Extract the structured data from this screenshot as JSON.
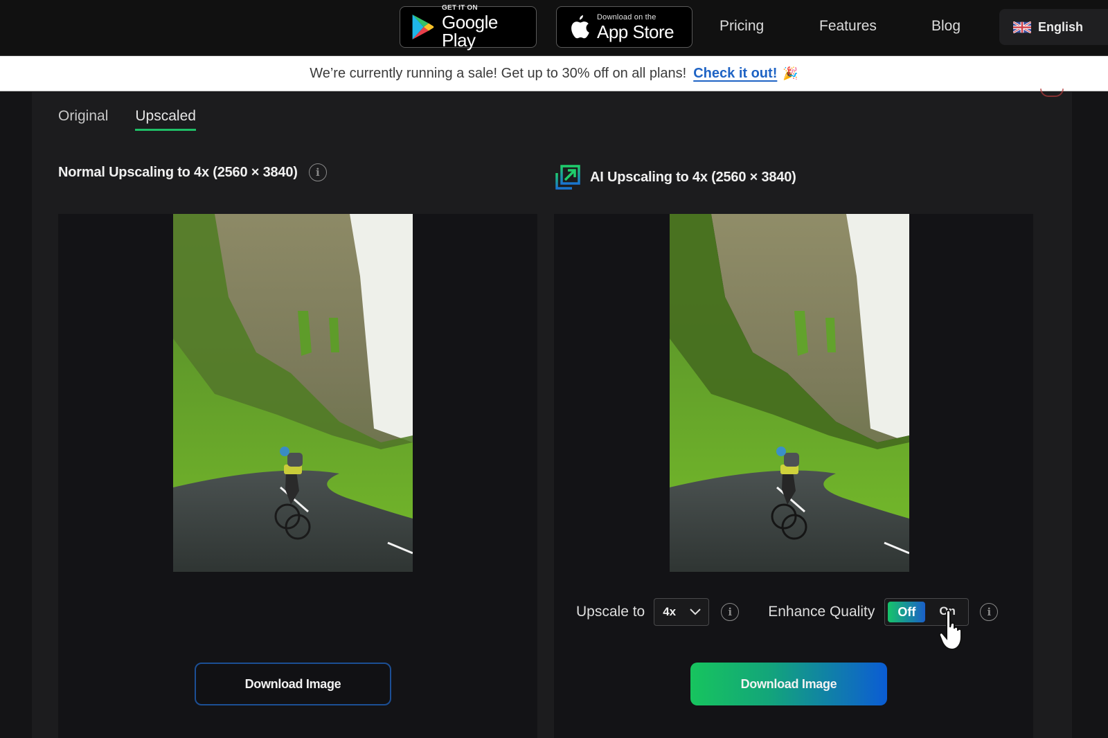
{
  "nav": {
    "google_play": {
      "small": "GET IT ON",
      "big": "Google Play",
      "icon": "google-play-icon"
    },
    "app_store": {
      "small": "Download on the",
      "big": "App Store",
      "icon": "apple-icon"
    },
    "links": [
      "Pricing",
      "Features",
      "Blog"
    ],
    "language": {
      "label": "English",
      "icon": "uk-flag-icon"
    }
  },
  "promo": {
    "message": "We’re currently running a sale! Get up to 30% off on all plans!",
    "cta": "Check it out!",
    "emoji": "🎉"
  },
  "tabs": [
    {
      "label": "Original",
      "active": false
    },
    {
      "label": "Upscaled",
      "active": true
    }
  ],
  "accent_colors": {
    "tab_underline": "#1fbf67",
    "gradient_start": "#17c45e",
    "gradient_end": "#0a5cd4",
    "outline_button": "#1c4f95"
  },
  "left_panel": {
    "title": "Normal Upscaling to 4x (2560 × 3840)",
    "info_icon": "info-icon",
    "image_alt": "Cyclist riding on a winding road below a mossy limestone cliff",
    "download_label": "Download Image"
  },
  "right_panel": {
    "title": "AI Upscaling to 4x (2560 × 3840)",
    "title_icon": "ai-upscale-icon",
    "image_alt": "Cyclist riding on a winding road below a mossy limestone cliff (AI upscaled)",
    "controls": {
      "upscale_label": "Upscale to",
      "upscale_value": "4x",
      "enhance_label": "Enhance Quality",
      "toggle_off": "Off",
      "toggle_on": "On",
      "toggle_state": "Off"
    },
    "download_label": "Download Image"
  }
}
